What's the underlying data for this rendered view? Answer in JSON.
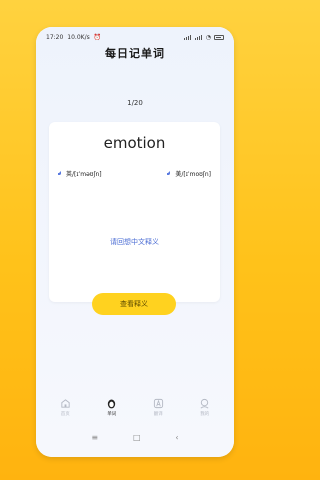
{
  "status": {
    "time": "17:20",
    "speed": "10.0K/s"
  },
  "header": {
    "title": "每日记单词"
  },
  "progress": {
    "counter": "1/20"
  },
  "card": {
    "word": "emotion",
    "phonetic_uk": "英/[ɪˈməʊʃn]",
    "phonetic_us": "美/[ɪˈmoʊʃn]",
    "hint": "请回想中文释义"
  },
  "actions": {
    "reveal": "查看释义"
  },
  "tabs": [
    {
      "label": "首页",
      "icon": "home-icon"
    },
    {
      "label": "单词",
      "icon": "egg-icon"
    },
    {
      "label": "翻译",
      "icon": "translate-icon"
    },
    {
      "label": "我的",
      "icon": "profile-icon"
    }
  ],
  "colors": {
    "background": "#FFC21A",
    "accent": "#FFD21F",
    "link": "#4A6CD4",
    "speaker": "#5B7BE0"
  }
}
